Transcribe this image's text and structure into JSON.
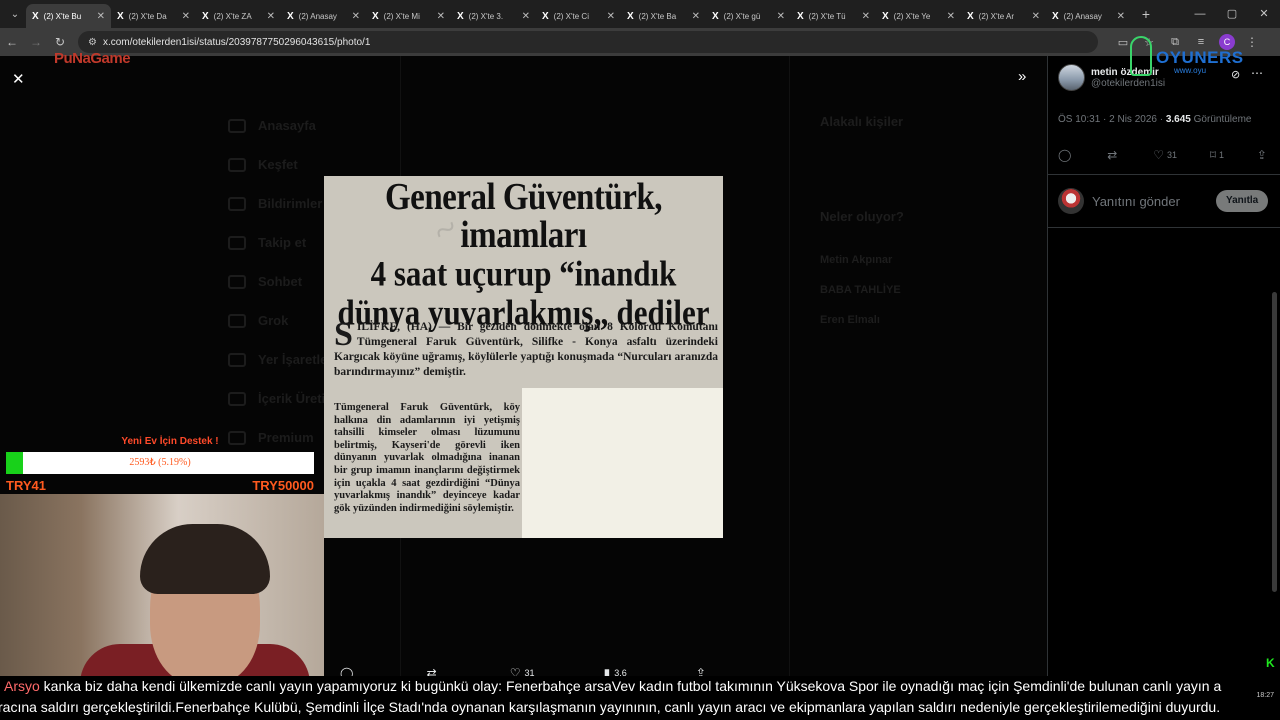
{
  "tabs": [
    {
      "label": "(2) X'te Bu",
      "active": true
    },
    {
      "label": "(2) X'te Da",
      "active": false
    },
    {
      "label": "(2) X'te ZA",
      "active": false
    },
    {
      "label": "(2) Anasay",
      "active": false
    },
    {
      "label": "(2) X'te Mi",
      "active": false
    },
    {
      "label": "(2) X'te 3.",
      "active": false
    },
    {
      "label": "(2) X'te Ci",
      "active": false
    },
    {
      "label": "(2) X'te Ba",
      "active": false
    },
    {
      "label": "(2) X'te gü",
      "active": false
    },
    {
      "label": "(2) X'te Tü",
      "active": false
    },
    {
      "label": "(2) X'te Ye",
      "active": false
    },
    {
      "label": "(2) X'te Ar",
      "active": false
    },
    {
      "label": "(2) Anasay",
      "active": false
    }
  ],
  "address": {
    "url": "x.com/otekilerden1isi/status/2039787750296043615/photo/1"
  },
  "background_nav": [
    "Anasayfa",
    "Keşfet",
    "Bildirimler",
    "Takip et",
    "Sohbet",
    "Grok",
    "Yer İşaretleri",
    "İçerik Üretici",
    "Premium"
  ],
  "background_right": {
    "related_title": "Alakalı kişiler",
    "trends_title": "Neler oluyor?",
    "trend_1": "Metin Akpınar",
    "trend_2": "BABA TAHLİYE",
    "trend_3": "Eren Elmalı"
  },
  "newspaper": {
    "headline_1": "General Güventürk, imamları",
    "headline_2": "4 saat uçurup “inandık",
    "headline_3": "dünya yuvarlakmış„ dediler",
    "dropcap": "S",
    "lede": "İLİFKE, (HA) — Bir geziden dönmekte olan 8 Kolordu Komutanı Tümgeneral Faruk Güventürk, Silifke - Konya asfaltı üzerindeki Kargıcak köyüne uğramış, köylülerle yaptığı konuşmada “Nurcuları aranızda barındırmayınız” demiştir.",
    "body": "Tümgeneral Faruk Güventürk, köy halkına din adamlarının iyi yetişmiş tahsilli kimseler olması lüzumunu belirtmiş, Kayseri'de görevli iken dünyanın yuvarlak olmadığına inanan bir grup imamın inançlarını değiştirmek için uçakla 4 saat gezdirdiğini “Dünya yuvarlakmış inandık” deyinceye kadar gök yüzünden indirmediğini söylemiştir."
  },
  "tweet": {
    "author_name": "metin özdemir",
    "author_handle": "@otekilerden1isi",
    "time": "ÖS 10:31 · 2 Nis 2026 ·",
    "views_count": "3.645",
    "views_label": "Görüntüleme",
    "likes": "31",
    "bookmarks": "1",
    "reply_placeholder": "Yanıtını gönder",
    "reply_button": "Yanıtla"
  },
  "viewer_actions": {
    "retweets": "",
    "likes": "31",
    "views": "3,6"
  },
  "overlays": {
    "logo_text_red": "PuNaGame",
    "brand_name": "OYUNERS",
    "brand_sub": "www.oyu",
    "donation_title": "Yeni Ev İçin Destek !",
    "donation_bar_text": "2593₺ (5.19%)",
    "donation_progress": 0.0519,
    "donation_min": "TRY41",
    "donation_max": "TRY50000",
    "corner_letter": "K"
  },
  "ticker": {
    "line1_name": "Arsyo",
    "line1_text": " kanka biz daha kendi ülkemizde canlı yayın yapamıyoruz ki bugünkü olay: Fenerbahçe arsaVev kadın futbol takımının Yüksekova Spor ile oynadığı maç için Şemdinli'de bulunan canlı yayın a",
    "line2_text": "racına saldırı gerçekleştirildi.Fenerbahçe Kulübü, Şemdinli İlçe Stadı'nda oynanan karşılaşmanın yayınının, canlı yayın aracı ve ekipmanlara yapılan saldırı nedeniyle gerçekleştirilemediğini duyurdu."
  },
  "clock": {
    "time": "18:27"
  },
  "colors": {
    "accent_green": "#18d11a",
    "donation_orange": "#ff5a1f",
    "x_bg": "#000000"
  }
}
